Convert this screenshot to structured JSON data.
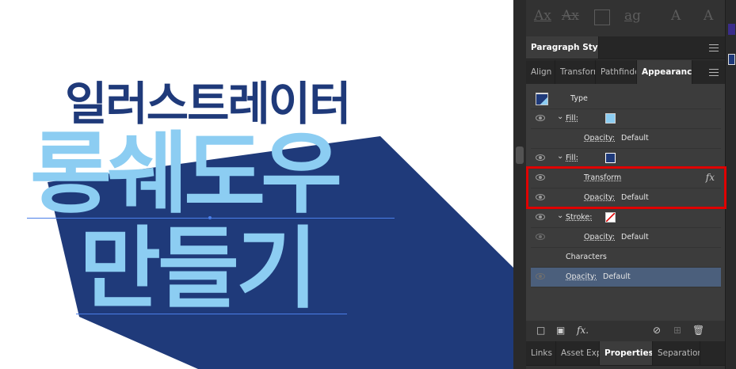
{
  "artboard": {
    "title_small": "일러스트레이터",
    "title_large_line1": "롱쉐도우",
    "title_large_line2": "만들기",
    "colors": {
      "shadow": "#1f3a7a",
      "fill": "#8ccdf2"
    }
  },
  "glyph_bar": {
    "icons": [
      "underline-text-icon",
      "strikethrough-text-icon",
      "case-box-icon",
      "lowercase-box-icon",
      "superscript-icon",
      "small-caps-icon"
    ]
  },
  "top_tabs": {
    "paragraph_styles": "Paragraph Styles"
  },
  "panel_tabs": {
    "align": "Align",
    "transform": "Transform",
    "pathfinder": "Pathfinder",
    "appearance": "Appearance"
  },
  "appearance": {
    "type_label": "Type",
    "rows": [
      {
        "label": "Fill:",
        "kind": "fill",
        "swatch": "#8ccdf2"
      },
      {
        "label": "Opacity:",
        "value": "Default"
      },
      {
        "label": "Fill:",
        "kind": "fill",
        "swatch": "#1f3a7a"
      },
      {
        "label": "Transform",
        "fx": "fx"
      },
      {
        "label": "Opacity:",
        "value": "Default"
      },
      {
        "label": "Stroke:",
        "kind": "stroke"
      },
      {
        "label": "Opacity:",
        "value": "Default"
      },
      {
        "label": "Characters"
      },
      {
        "label": "Opacity:",
        "value": "Default"
      }
    ]
  },
  "footer_icons": [
    "new-stroke-icon",
    "new-fill-icon",
    "add-effect-icon",
    "clear-appearance-icon",
    "duplicate-item-icon",
    "delete-icon"
  ],
  "footer_fx": "fx.",
  "bottom_tabs": {
    "links": "Links",
    "asset_export": "Asset Export",
    "properties": "Properties",
    "separations": "Separations"
  }
}
